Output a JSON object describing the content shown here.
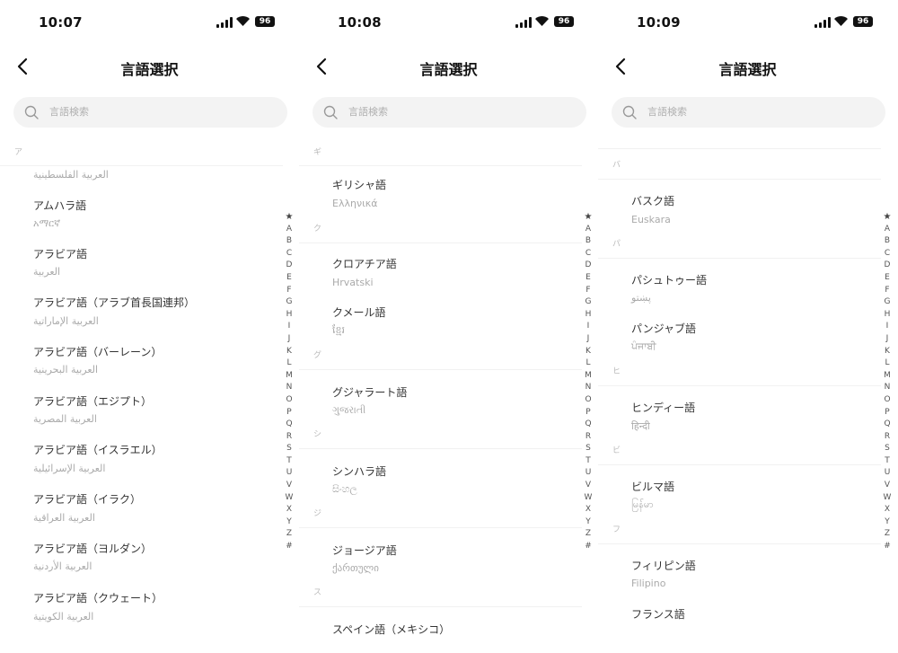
{
  "title": "言語選択",
  "search_placeholder": "言語検索",
  "index": [
    "★",
    "A",
    "B",
    "C",
    "D",
    "E",
    "F",
    "G",
    "H",
    "I",
    "J",
    "K",
    "L",
    "M",
    "N",
    "O",
    "P",
    "Q",
    "R",
    "S",
    "T",
    "U",
    "V",
    "W",
    "X",
    "Y",
    "Z",
    "#"
  ],
  "screens": [
    {
      "time": "10:07",
      "battery": "96",
      "headers": [
        "ア"
      ],
      "rows": [
        {
          "name": "",
          "native": "العربية الفلسطينية"
        },
        {
          "name": "アムハラ語",
          "native": "አማርኛ"
        },
        {
          "name": "アラビア語",
          "native": "العربية"
        },
        {
          "name": "アラビア語（アラブ首長国連邦）",
          "native": "العربية الإماراتية"
        },
        {
          "name": "アラビア語（バーレーン）",
          "native": "العربية البحرينية"
        },
        {
          "name": "アラビア語（エジプト）",
          "native": "العربية المصرية"
        },
        {
          "name": "アラビア語（イスラエル）",
          "native": "العربية الإسرائيلية"
        },
        {
          "name": "アラビア語（イラク）",
          "native": "العربية العراقية"
        },
        {
          "name": "アラビア語（ヨルダン）",
          "native": "العربية الأردنية"
        },
        {
          "name": "アラビア語（クウェート）",
          "native": "العربية الكويتية"
        }
      ]
    },
    {
      "time": "10:08",
      "battery": "96",
      "headers": [
        "ギ",
        "ク",
        "グ",
        "シ",
        "ジ",
        "ス"
      ],
      "rows": [
        {
          "name": "ギリシャ語",
          "native": "Ελληνικά"
        },
        {
          "name": "クロアチア語",
          "native": "Hrvatski"
        },
        {
          "name": "クメール語",
          "native": "ខ្មែរ"
        },
        {
          "name": "グジャラート語",
          "native": "ગુજરાતી"
        },
        {
          "name": "シンハラ語",
          "native": "සිංහල"
        },
        {
          "name": "ジョージア語",
          "native": "ქართული"
        },
        {
          "name": "スペイン語（メキシコ）",
          "native": ""
        }
      ]
    },
    {
      "time": "10:09",
      "battery": "96",
      "headers": [
        "バ",
        "パ",
        "ヒ",
        "ビ",
        "フ"
      ],
      "rows": [
        {
          "name": "バスク語",
          "native": "Euskara"
        },
        {
          "name": "パシュトゥー語",
          "native": "پښتو"
        },
        {
          "name": "パンジャブ語",
          "native": "ਪੰਜਾਬੀ"
        },
        {
          "name": "ヒンディー語",
          "native": "हिन्दी"
        },
        {
          "name": "ビルマ語",
          "native": "မြန်မာ"
        },
        {
          "name": "フィリピン語",
          "native": "Filipino"
        },
        {
          "name": "フランス語",
          "native": ""
        }
      ]
    }
  ]
}
